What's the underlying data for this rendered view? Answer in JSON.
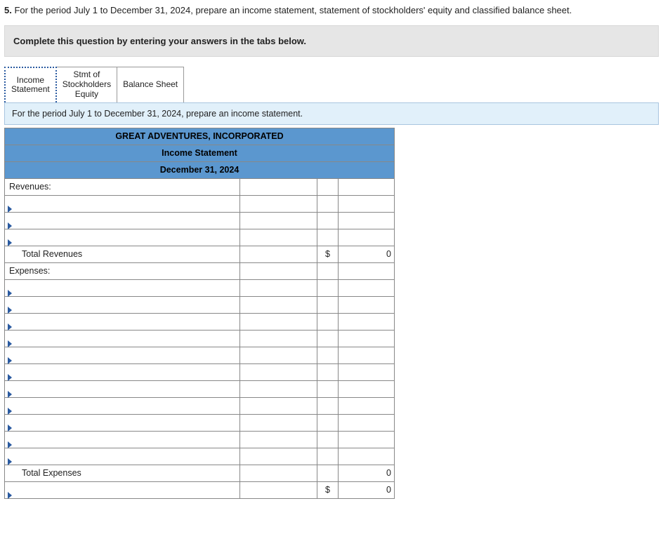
{
  "question": {
    "number": "5.",
    "text": "For the period July 1 to December 31, 2024, prepare an income statement, statement of stockholders' equity and classified balance sheet."
  },
  "instruction": "Complete this question by entering your answers in the tabs below.",
  "tabs": [
    {
      "label": "Income\nStatement",
      "active": true
    },
    {
      "label": "Stmt of\nStockholders\nEquity",
      "active": false
    },
    {
      "label": "Balance Sheet",
      "active": false
    }
  ],
  "subprompt": "For the period July 1 to December 31, 2024, prepare an income statement.",
  "statement": {
    "company": "GREAT ADVENTURES, INCORPORATED",
    "title": "Income Statement",
    "date": "December 31, 2024",
    "rows": [
      {
        "type": "section",
        "label": "Revenues:"
      },
      {
        "type": "dropdown"
      },
      {
        "type": "dropdown"
      },
      {
        "type": "dropdown"
      },
      {
        "type": "total",
        "label": "Total Revenues",
        "currency": "$",
        "amount": "0"
      },
      {
        "type": "section",
        "label": "Expenses:"
      },
      {
        "type": "dropdown"
      },
      {
        "type": "dropdown"
      },
      {
        "type": "dropdown"
      },
      {
        "type": "dropdown"
      },
      {
        "type": "dropdown"
      },
      {
        "type": "dropdown"
      },
      {
        "type": "dropdown"
      },
      {
        "type": "dropdown"
      },
      {
        "type": "dropdown"
      },
      {
        "type": "dropdown"
      },
      {
        "type": "dropdown"
      },
      {
        "type": "total",
        "label": "Total Expenses",
        "currency": "",
        "amount": "0"
      },
      {
        "type": "dropdown_total",
        "currency": "$",
        "amount": "0"
      }
    ]
  }
}
